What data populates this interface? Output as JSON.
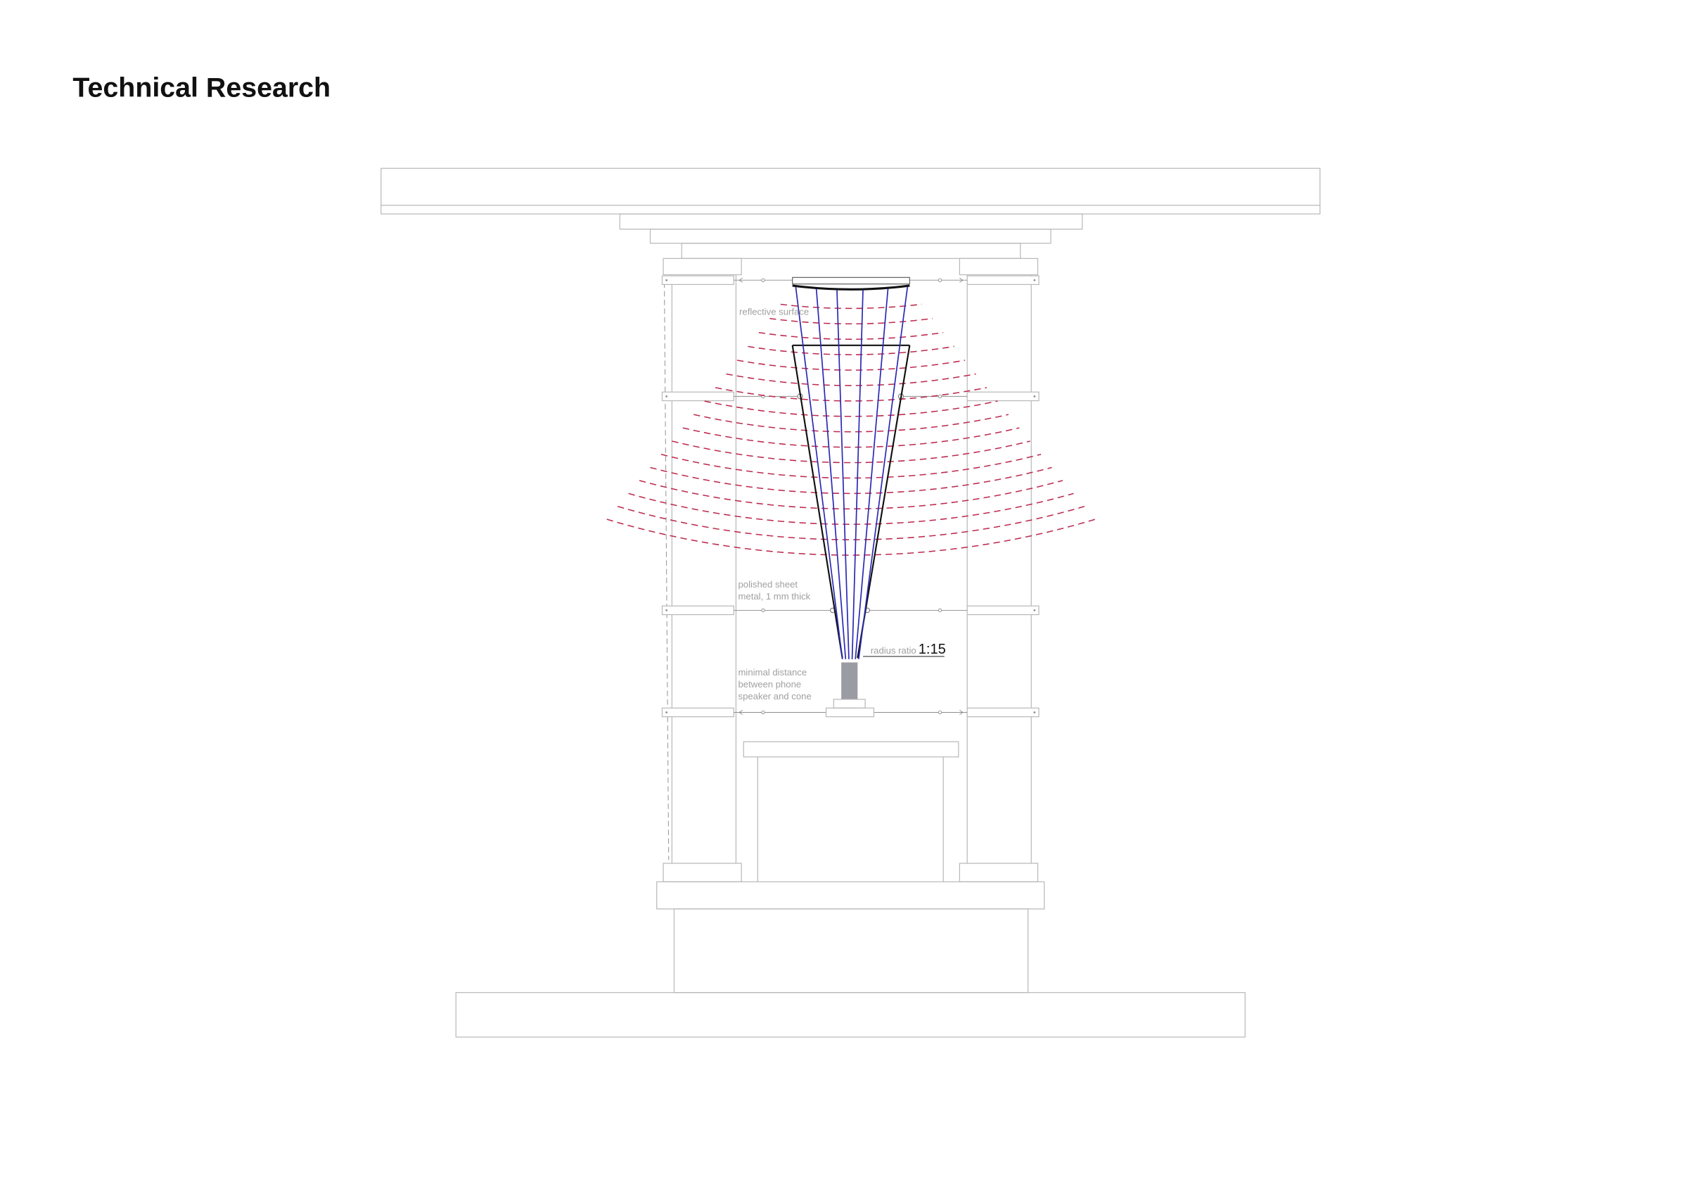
{
  "page": {
    "title": "Technical Research"
  },
  "annotations": {
    "reflective_surface": "reflective surface",
    "polished_sheet": [
      "polished sheet",
      "metal, 1 mm thick"
    ],
    "radius_ratio_label": "radius ratio",
    "radius_ratio_value": "1:15",
    "minimal_distance": [
      "minimal distance",
      "between phone",
      "speaker and cone"
    ]
  },
  "colors": {
    "outline": "#b9b9b9",
    "cone": "#111111",
    "rays": "#2a2ab4",
    "waves": "#bd2a4e",
    "phone": "#9b9ba3",
    "label": "#a0a0a0"
  }
}
